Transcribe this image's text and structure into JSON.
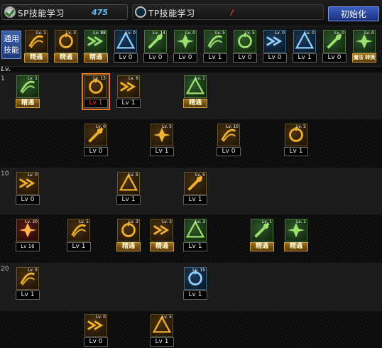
{
  "tabs": {
    "sp": {
      "label": "SP技能学习",
      "points": "475"
    },
    "tp": {
      "label": "TP技能学习",
      "points": "/"
    }
  },
  "reset_label": "初始化",
  "common": {
    "label": "通用技能",
    "skills": [
      {
        "level": "Lv. 1",
        "text": "精通",
        "style": "mastery",
        "theme": "gold"
      },
      {
        "level": "Lv. 3",
        "text": "精通",
        "style": "mastery",
        "theme": "gold"
      },
      {
        "level": "Lv. 88",
        "text": "精通",
        "style": "mastery",
        "theme": "green"
      },
      {
        "level": "Lv. 0",
        "text": "Lv 0",
        "style": "normal",
        "theme": "blue"
      },
      {
        "level": "Lv. 14",
        "text": "Lv 0",
        "style": "normal",
        "theme": "green"
      },
      {
        "level": "Lv. 0",
        "text": "Lv 0",
        "style": "normal",
        "theme": "green"
      },
      {
        "level": "Lv. 5",
        "text": "Lv 1",
        "style": "normal",
        "theme": "green"
      },
      {
        "level": "Lv. 5",
        "text": "Lv 0",
        "style": "normal",
        "theme": "green"
      },
      {
        "level": "Lv. 0",
        "text": "Lv 0",
        "style": "normal",
        "theme": "blue"
      },
      {
        "level": "Lv. 0",
        "text": "Lv 1",
        "style": "normal",
        "theme": "blue"
      },
      {
        "level": "Lv. 0",
        "text": "Lv 0",
        "style": "normal",
        "theme": "green"
      },
      {
        "level": "Lv. 0",
        "text": "魔法 转换",
        "style": "mastery",
        "theme": "green"
      }
    ]
  },
  "grid": {
    "header": "Lv.",
    "row_labels": [
      "1",
      "10",
      "20"
    ],
    "rows": [
      [
        {
          "col": 0,
          "level": "Lv. 1",
          "text": "精通",
          "style": "mastery",
          "theme": "green"
        },
        {
          "col": 2,
          "level": "Lv. 13",
          "text": "Lv 1",
          "style": "active",
          "theme": "gold",
          "selected": true
        },
        {
          "col": 3,
          "level": "Lv. 6",
          "text": "Lv 1",
          "style": "normal",
          "theme": "gold"
        },
        {
          "col": 5,
          "level": "Lv. 1",
          "text": "精通",
          "style": "mastery",
          "theme": "green"
        }
      ],
      [
        {
          "col": 2,
          "level": "Lv. 0",
          "text": "Lv 0",
          "style": "normal",
          "theme": "gold"
        },
        {
          "col": 4,
          "level": "Lv. 5",
          "text": "Lv 1",
          "style": "normal",
          "theme": "gold"
        },
        {
          "col": 6,
          "level": "Lv. 10",
          "text": "Lv 0",
          "style": "normal",
          "theme": "gold"
        },
        {
          "col": 8,
          "level": "Lv. 5",
          "text": "Lv 1",
          "style": "normal",
          "theme": "gold"
        }
      ],
      [
        {
          "col": 0,
          "level": "Lv. 0",
          "text": "Lv 0",
          "style": "normal",
          "theme": "gold"
        },
        {
          "col": 3,
          "level": "Lv. 5",
          "text": "Lv 1",
          "style": "normal",
          "theme": "gold"
        },
        {
          "col": 5,
          "level": "Lv. 5",
          "text": "Lv 1",
          "style": "normal",
          "theme": "gold"
        }
      ],
      [
        {
          "col": 0,
          "level": "Lv. 20",
          "text": "Lv 16",
          "style": "normal",
          "theme": "red"
        },
        {
          "col": 1,
          "level": "Lv. 5",
          "text": "Lv 1",
          "style": "normal",
          "theme": "gold"
        },
        {
          "col": 3,
          "level": "Lv. 3",
          "text": "精通",
          "style": "mastery",
          "theme": "gold"
        },
        {
          "col": 4,
          "level": "Lv. 3",
          "text": "精通",
          "style": "mastery",
          "theme": "gold"
        },
        {
          "col": 5,
          "level": "Lv. 3",
          "text": "Lv 1",
          "style": "normal",
          "theme": "green"
        },
        {
          "col": 7,
          "level": "Lv. 1",
          "text": "精通",
          "style": "mastery",
          "theme": "green"
        },
        {
          "col": 8,
          "level": "Lv. 1",
          "text": "精通",
          "style": "mastery",
          "theme": "green"
        }
      ],
      [
        {
          "col": 0,
          "level": "Lv. 5",
          "text": "Lv 1",
          "style": "normal",
          "theme": "gold"
        },
        {
          "col": 5,
          "level": "Lv. 15",
          "text": "Lv 1",
          "style": "normal",
          "theme": "blue"
        }
      ],
      [
        {
          "col": 2,
          "level": "Lv. 0",
          "text": "Lv 0",
          "style": "normal",
          "theme": "gold"
        },
        {
          "col": 4,
          "level": "Lv. 5",
          "text": "Lv 1",
          "style": "normal",
          "theme": "gold"
        }
      ]
    ]
  }
}
